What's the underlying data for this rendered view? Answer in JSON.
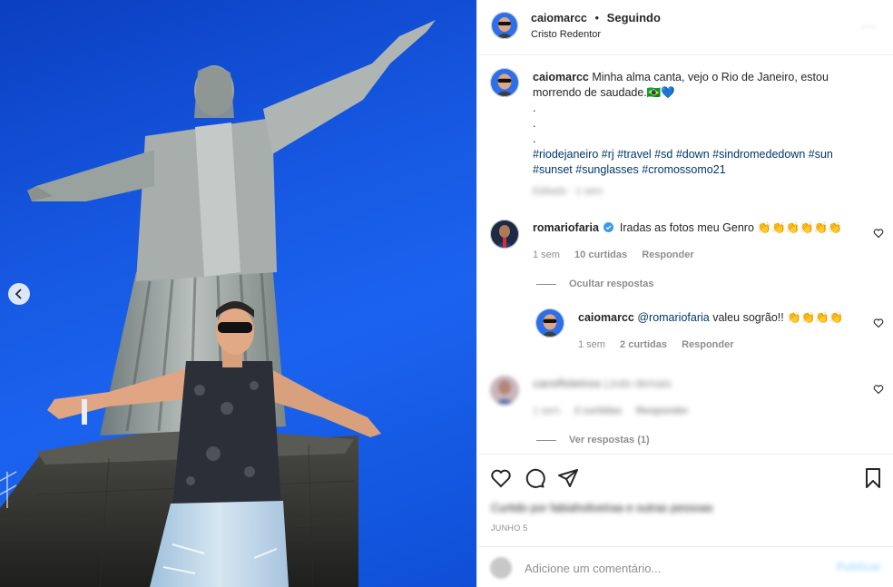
{
  "colors": {
    "accent_link": "#00376b",
    "muted": "#8e8e8e",
    "verified": "#3897f0",
    "sky": "#1657e0"
  },
  "photo": {
    "carousel_prev_icon": "chevron-left-icon",
    "image_label": ""
  },
  "header": {
    "username": "caiomarcc",
    "separator": "•",
    "follow_status": "Seguindo",
    "location": "Cristo Redentor",
    "more_icon": "more-options-icon",
    "more_label": "···"
  },
  "caption": {
    "username": "caiomarcc",
    "text": "Minha alma canta, vejo o Rio de Janeiro, estou morrendo de saudade.🇧🇷💙",
    "dots": [
      ".",
      ".",
      "."
    ],
    "hashtags": [
      "#riodejaneiro",
      "#rj",
      "#travel",
      "#sd",
      "#down",
      "#sindromededown",
      "#sun",
      "#sunset",
      "#sunglasses",
      "#cromossomo21"
    ],
    "meta_blurred": "Editado · 1 sem"
  },
  "comments": [
    {
      "username": "romariofaria",
      "verified": true,
      "text": "Iradas as fotos meu Genro 👏👏👏👏👏👏",
      "time": "1 sem",
      "likes": "10 curtidas",
      "reply_label": "Responder",
      "replies_toggle": "Ocultar respostas",
      "replies": [
        {
          "username": "caiomarcc",
          "mention": "@romariofaria",
          "text": " valeu sogrão!! 👏👏👏👏",
          "time": "1 sem",
          "likes": "2 curtidas",
          "reply_label": "Responder"
        }
      ]
    },
    {
      "username_blurred": "carolfoleiros",
      "text_blurred": "Lindo demais",
      "time_blurred": "1 sem",
      "likes_blurred": "2 curtidas",
      "reply_label_blurred": "Responder",
      "replies_toggle": "Ver respostas (1)"
    }
  ],
  "actions": {
    "like_icon": "heart-icon",
    "comment_icon": "comment-icon",
    "share_icon": "share-icon",
    "save_icon": "bookmark-icon",
    "likes_blurred": "Curtido por fabiaholiveiraa e outras pessoas",
    "date": "JUNHO 5"
  },
  "add_comment": {
    "emoji_icon": "emoji-icon",
    "placeholder": "Adicione um comentário...",
    "post_label": "Publicar"
  }
}
